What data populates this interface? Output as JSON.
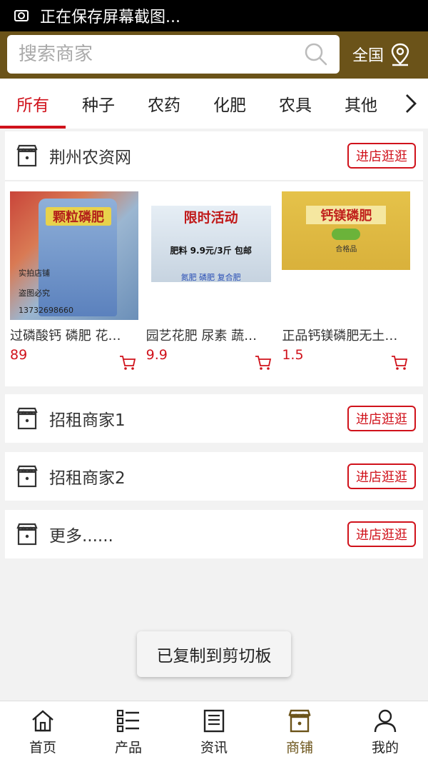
{
  "status_bar": {
    "text": "正在保存屏幕截图..."
  },
  "header": {
    "search_placeholder": "搜索商家",
    "region": "全国"
  },
  "tabs": [
    "所有",
    "种子",
    "农药",
    "化肥",
    "农具",
    "其他"
  ],
  "shops": [
    {
      "name": "荆州农资网",
      "button": "进店逛逛",
      "products": [
        {
          "name": "过磷酸钙 磷肥 花卉专用",
          "price": "89",
          "img_title": "颗粒磷肥",
          "img_lines": [
            "实拍店铺",
            "盗图必究",
            "13732698660"
          ]
        },
        {
          "name": "园艺花肥 尿素 蔬菜肥料",
          "price": "9.9",
          "img_title": "限时活动",
          "img_lines": [
            "肥料 9.9元/3斤 包邮",
            "氮肥 磷肥 复合肥"
          ]
        },
        {
          "name": "正品钙镁磷肥无土栽培",
          "price": "1.5",
          "img_title": "钙镁磷肥",
          "img_lines": [
            "合格品"
          ]
        }
      ]
    },
    {
      "name": "招租商家1",
      "button": "进店逛逛"
    },
    {
      "name": "招租商家2",
      "button": "进店逛逛"
    },
    {
      "name": "更多......",
      "button": "进店逛逛"
    }
  ],
  "toast": "已复制到剪切板",
  "bottom_nav": [
    {
      "label": "首页",
      "icon": "home-icon"
    },
    {
      "label": "产品",
      "icon": "list-icon"
    },
    {
      "label": "资讯",
      "icon": "news-icon"
    },
    {
      "label": "商铺",
      "icon": "shop-icon",
      "active": true
    },
    {
      "label": "我的",
      "icon": "user-icon"
    }
  ],
  "colors": {
    "brand": "#6b5319",
    "accent": "#d0121b"
  }
}
